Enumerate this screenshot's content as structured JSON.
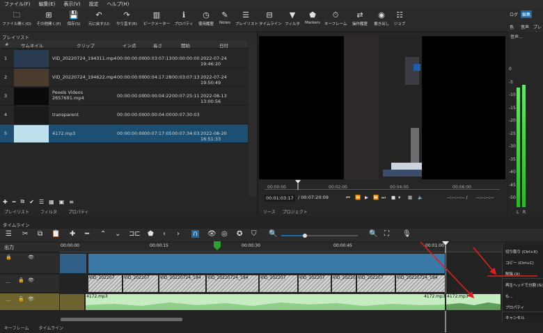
{
  "menu": [
    "ファイル(F)",
    "編集(E)",
    "表示(V)",
    "設定",
    "ヘルプ(H)"
  ],
  "toolbar": [
    {
      "label": "ファイル開く(O)",
      "icon": "folder-icon"
    },
    {
      "label": "その他開く(P)",
      "icon": "open-other-icon"
    },
    {
      "label": "保存(S)",
      "icon": "save-icon"
    },
    {
      "label": "元に戻す(U)",
      "icon": "undo-icon"
    },
    {
      "label": "やり直す(R)",
      "icon": "redo-icon"
    },
    {
      "label": "ピークメーター",
      "icon": "peak-meter-icon"
    },
    {
      "label": "プロパティ",
      "icon": "info-icon"
    },
    {
      "label": "使用履歴",
      "icon": "history-icon"
    },
    {
      "label": "Notes",
      "icon": "notes-icon"
    },
    {
      "label": "プレイリスト",
      "icon": "playlist-icon"
    },
    {
      "label": "タイムライン",
      "icon": "timeline-icon"
    },
    {
      "label": "フィルタ",
      "icon": "filter-icon"
    },
    {
      "label": "Markers",
      "icon": "marker-icon"
    },
    {
      "label": "キーフレーム",
      "icon": "keyframe-icon"
    },
    {
      "label": "操作履歴",
      "icon": "jobs-history-icon"
    },
    {
      "label": "書き出し",
      "icon": "export-icon"
    },
    {
      "label": "ジョブ",
      "icon": "jobs-icon"
    }
  ],
  "layouts": {
    "log": "ログ",
    "edit": "編集",
    "color": "色",
    "audio": "音声",
    "player": "プレイ"
  },
  "playlist": {
    "title": "プレイリスト",
    "columns": [
      "#",
      "サムネイル",
      "クリップ",
      "イン点",
      "長さ",
      "開始",
      "日付"
    ],
    "rows": [
      {
        "num": "1",
        "clip": "VID_20220724_194311.mp4",
        "in": "00:00:00:00",
        "dur": "00:03:07:13",
        "start": "00:00:00:00",
        "date": "2022-07-24 19:46:20"
      },
      {
        "num": "2",
        "clip": "VID_20220724_194622.mp4",
        "in": "00:00:00:00",
        "dur": "00:04:17:28",
        "start": "00:03:07:13",
        "date": "2022-07-24 19:50:49"
      },
      {
        "num": "3",
        "clip": "Pexels Videos 2657691.mp4",
        "in": "00:00:00:00",
        "dur": "00:00:04:22",
        "start": "00:07:25:11",
        "date": "2022-08-13 13:00:56"
      },
      {
        "num": "4",
        "clip": "transparent",
        "in": "00:00:00:00",
        "dur": "00:00:04:00",
        "start": "00:07:30:03",
        "date": ""
      },
      {
        "num": "5",
        "clip": "4172.mp3",
        "in": "00:00:00:00",
        "dur": "00:07:17:05",
        "start": "00:07:34:03",
        "date": "2022-08-20 16:51:33"
      }
    ],
    "tabs": [
      "プレイリスト",
      "フィルタ",
      "プロパティ"
    ]
  },
  "viewer": {
    "ruler_marks": [
      "00:00:00",
      "00:02:00",
      "00:04:00",
      "00:06:00"
    ],
    "position": "00:01:03:17",
    "duration": "/ 00:07:20:09",
    "in_point": "--:--:--:-- /",
    "out_point": "--:--:--:--",
    "tabs": [
      "ソース",
      "プロジェクト"
    ]
  },
  "meter": {
    "title": "音声...",
    "scale": [
      "0",
      "-5",
      "-10",
      "-15",
      "-20",
      "-25",
      "-30",
      "-35",
      "-40",
      "-45",
      "-50"
    ],
    "channels": [
      "L",
      "R"
    ]
  },
  "timeline": {
    "title": "タイムライン",
    "output_label": "出力",
    "ruler": [
      "00:00:00",
      "00:00:15",
      "00:00:30",
      "00:00:45",
      "00:01:00"
    ],
    "video_clip_label": "VID_202207",
    "video_clip_label_long": "VID_20220724_194",
    "audio_clip_label": "4172.mp3",
    "tabs": [
      "キーフレーム",
      "タイムライン"
    ]
  },
  "context_menu": [
    "切り取り (Ctrl+X)",
    "コピー (Ctrl+C)",
    "削除 (X)",
    "再生ヘッドで分割 (S)",
    "も...",
    "プロパティ",
    "キャンセル"
  ],
  "colors": {
    "selection": "#1d4f73",
    "video_clip": "#3a78a8",
    "audio_clip": "#c6ecc2",
    "annotation": "#e02020",
    "accent": "#1e6aa6"
  }
}
